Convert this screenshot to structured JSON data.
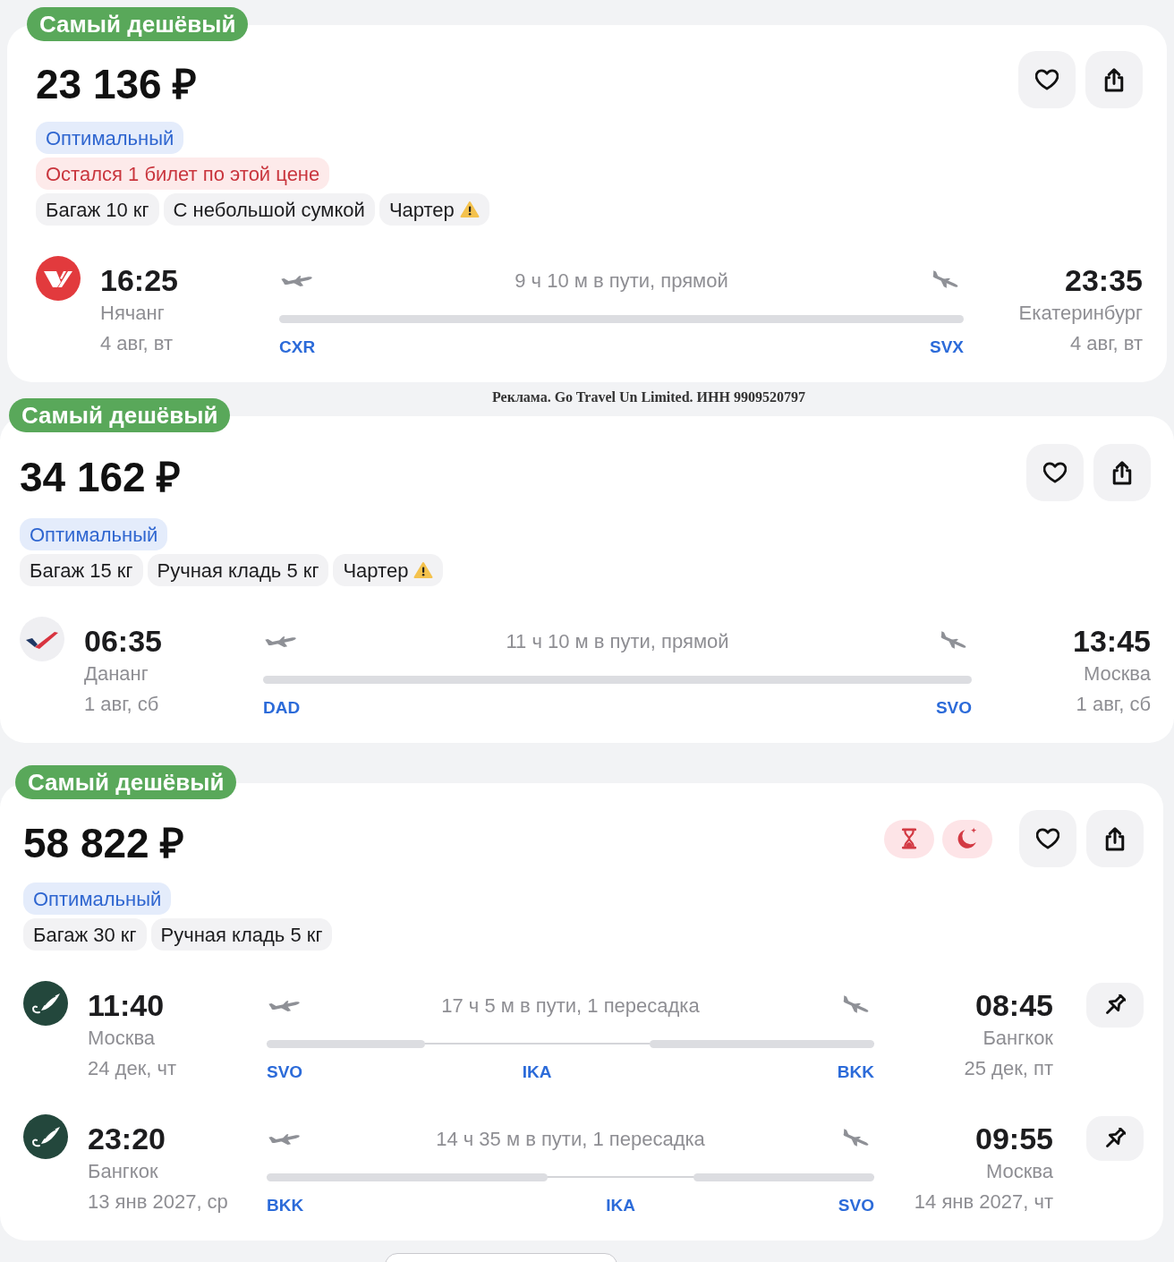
{
  "results": [
    {
      "kind": "flight_card",
      "badge": "Самый дешёвый",
      "price": "23 136 ₽",
      "labels": [
        {
          "text": "Оптимальный",
          "kind": "highlight"
        },
        {
          "text": "Остался 1 билет по этой цене",
          "kind": "alert"
        }
      ],
      "features": [
        {
          "text": "Багаж 10 кг",
          "warning": false
        },
        {
          "text": "С небольшой сумкой",
          "warning": false
        },
        {
          "text": "Чартер",
          "warning": true
        }
      ],
      "flights": [
        {
          "kind": "stripes",
          "departure": {
            "time": "16:25",
            "city": "Нячанг",
            "date": "4 авг, вт"
          },
          "duration": "9 ч 10 м в пути, прямой",
          "airports": [
            "CXR",
            "SVX"
          ],
          "arrival": {
            "time": "23:35",
            "city": "Екатеринбург",
            "date": "4 авг, вт"
          }
        }
      ]
    },
    {
      "kind": "ad_notice",
      "text": "Реклама. Go Travel Un Limited. ИНН 9909520797"
    },
    {
      "kind": "flight_card",
      "badge": "Самый дешёвый",
      "price": "34 162 ₽",
      "labels": [
        {
          "text": "Оптимальный",
          "kind": "highlight"
        }
      ],
      "features": [
        {
          "text": "Багаж 15 кг",
          "warning": false
        },
        {
          "text": "Ручная кладь 5 кг",
          "warning": false
        },
        {
          "text": "Чартер",
          "warning": true
        }
      ],
      "flights": [
        {
          "kind": "swoosh",
          "departure": {
            "time": "06:35",
            "city": "Дананг",
            "date": "1 авг, сб"
          },
          "duration": "11 ч 10 м в пути, прямой",
          "airports": [
            "DAD",
            "SVO"
          ],
          "arrival": {
            "time": "13:45",
            "city": "Москва",
            "date": "1 авг, сб"
          }
        }
      ]
    },
    {
      "kind": "flight_card",
      "badge": "Самый дешёвый",
      "price": "58 822 ₽",
      "alerts": [
        {
          "kind": "duration"
        },
        {
          "kind": "night"
        }
      ],
      "labels": [
        {
          "text": "Оптимальный",
          "kind": "highlight"
        }
      ],
      "features": [
        {
          "text": "Багаж 30 кг",
          "warning": false
        },
        {
          "text": "Ручная кладь 5 кг",
          "warning": false
        }
      ],
      "flights": [
        {
          "kind": "wing",
          "departure": {
            "time": "11:40",
            "city": "Москва",
            "date": "24 дек, чт"
          },
          "duration": "17 ч 5 м в пути, 1 пересадка",
          "legs": [
            {
              "level": 0.26
            },
            {
              "level": 0.37
            }
          ],
          "airports": [
            "SVO",
            "IKA",
            "BKK"
          ],
          "arrival": {
            "time": "08:45",
            "city": "Бангкок",
            "date": "25 дек, пт"
          },
          "pin_button": true
        },
        {
          "kind": "wing",
          "departure": {
            "time": "23:20",
            "city": "Бангкок",
            "date": "13 янв 2027, ср"
          },
          "duration": "14 ч 35 м в пути, 1 пересадка",
          "legs": [
            {
              "level": 0.462
            },
            {
              "level": 0.297
            }
          ],
          "airports": [
            "BKK",
            "IKA",
            "SVO"
          ],
          "arrival": {
            "time": "09:55",
            "city": "Москва",
            "date": "14 янв 2027, чт"
          },
          "pin_button": true
        }
      ]
    }
  ]
}
